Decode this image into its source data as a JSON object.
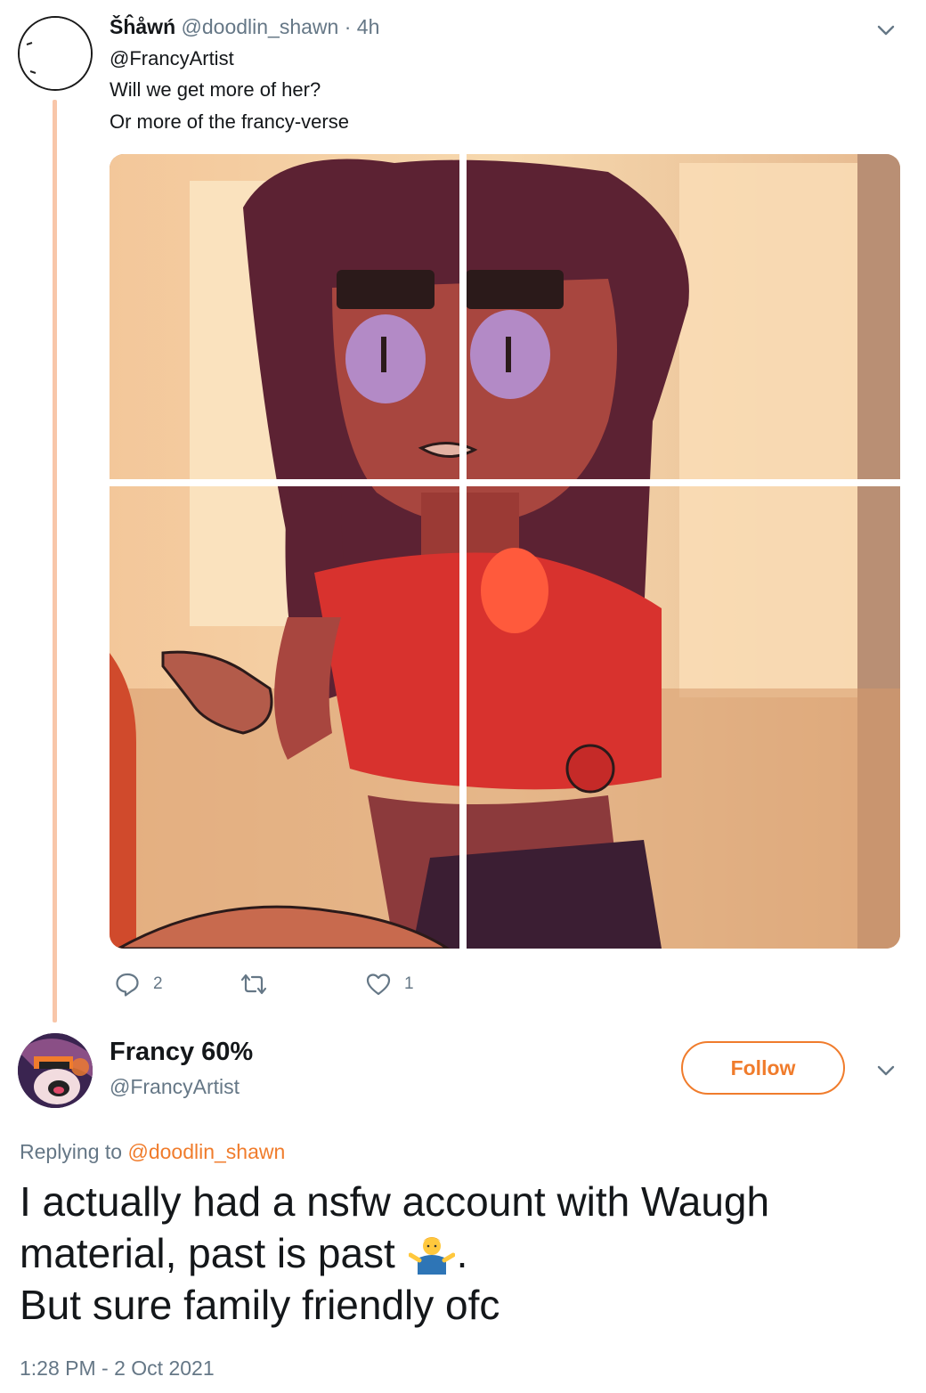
{
  "parent_tweet": {
    "display_name": "Šĥåwń",
    "handle": "@doodlin_shawn",
    "separator": "·",
    "time_ago": "4h",
    "mention": "@FrancyArtist",
    "text_lines": [
      "Will we get more of her?",
      "Or more of the francy-verse"
    ],
    "actions": {
      "reply_count": "2",
      "retweet_count": "",
      "like_count": "1"
    }
  },
  "reply_tweet": {
    "display_name": "Francy 60%",
    "handle": "@FrancyArtist",
    "follow_label": "Follow",
    "replying_prefix": "Replying to",
    "replying_handle": "@doodlin_shawn",
    "text_line1": "I actually had a nsfw account with Waugh",
    "text_line2_before": "material, past is past",
    "text_line2_after": ".",
    "text_line3": "But sure family friendly ofc",
    "emoji": "person-shrugging-emoji",
    "timestamp": "1:28 PM - 2 Oct 2021"
  },
  "icons": {
    "reply": "speech-bubble-icon",
    "retweet": "retweet-icon",
    "like": "heart-icon",
    "menu": "chevron-down-icon"
  },
  "colors": {
    "accent": "#f07c2c",
    "muted_text": "#657786",
    "thread_line": "#f8c6a9"
  }
}
